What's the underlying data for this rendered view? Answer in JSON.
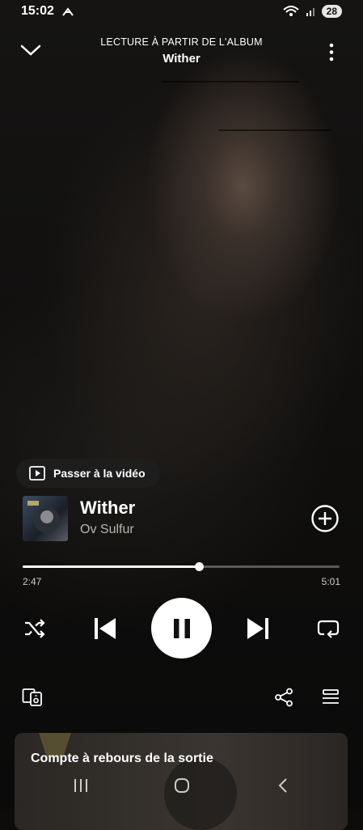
{
  "status_bar": {
    "time": "15:02",
    "battery": "28"
  },
  "header": {
    "context_label": "LECTURE À PARTIR DE L'ALBUM",
    "album_title": "Wither"
  },
  "video_button": {
    "label": "Passer à la vidéo"
  },
  "track": {
    "title": "Wither",
    "artist": "Ov Sulfur"
  },
  "progress": {
    "elapsed": "2:47",
    "duration": "5:01",
    "fraction": 0.555
  },
  "card": {
    "title": "Compte à rebours de la sortie"
  },
  "icons": {
    "collapse": "chevron-down-icon",
    "more": "more-vertical-icon",
    "shuffle": "shuffle-icon",
    "previous": "skip-previous-icon",
    "pause": "pause-icon",
    "next": "skip-next-icon",
    "repeat": "repeat-icon",
    "devices": "connect-device-icon",
    "share": "share-icon",
    "queue": "queue-icon",
    "add": "add-circle-icon"
  }
}
